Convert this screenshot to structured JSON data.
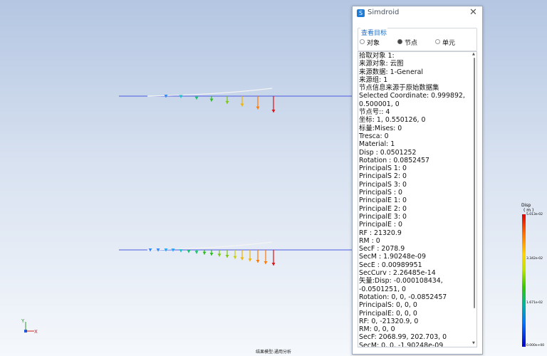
{
  "dialog": {
    "title": "Simdroid",
    "close_glyph": "✕",
    "group_title": "查看目标",
    "radio_options": [
      "对象",
      "节点",
      "单元"
    ],
    "selected_option": "节点",
    "info_lines": [
      "拾取对象 1:",
      "来源对象: 云图",
      "来源数据: 1-General",
      "来源组: 1",
      "节点信息来源于原始数据集",
      "Selected Coordinate: 0.999892, 0.500001, 0",
      "节点号:: 4",
      "坐标: 1, 0.550126, 0",
      "标量:Mises: 0",
      "Tresca: 0",
      "Material: 1",
      "Disp : 0.0501252",
      "Rotation : 0.0852457",
      "PrincipalS 1: 0",
      "PrincipalS 2: 0",
      "PrincipalS 3: 0",
      "PrincipalS : 0",
      "PrincipalE 1: 0",
      "PrincipalE 2: 0",
      "PrincipalE 3: 0",
      "PrincipalE : 0",
      "RF : 21320.9",
      "RM : 0",
      "SecF : 2078.9",
      "SecM : 1.90248e-09",
      "SecE : 0.00989951",
      "SecCurv : 2.26485e-14",
      "矢量:Disp: -0.000108434, -0.0501251, 0",
      "Rotation: 0, 0, -0.0852457",
      "PrincipalS: 0, 0, 0",
      "PrincipalE: 0, 0, 0",
      "RF: 0, -21320.9, 0",
      "RM: 0, 0, 0",
      "SecF: 2068.99, 202.703, 0",
      "SecM: 0, 0, -1.90248e-09"
    ]
  },
  "legend": {
    "title": "Disp",
    "unit": "( m )",
    "ticks": [
      "5.013e-02",
      "3.342e-02",
      "1.671e-02",
      "0.000e+00"
    ],
    "colors": [
      "#e00000",
      "#ff6a00",
      "#ffd200",
      "#35c800",
      "#00b39b",
      "#0073ff",
      "#0000cc"
    ]
  },
  "triad": {
    "x_label": "X",
    "y_label": "Y"
  },
  "status": {
    "model_type": "结果模型:通用分析"
  },
  "beams": {
    "line_color": "#4d5ae0",
    "deformed_color": "#f4f4f4",
    "arrow_colors": [
      "#3a55ff",
      "#2f86ff",
      "#1aa9ff",
      "#12c2c8",
      "#18c46a",
      "#2fbd1e",
      "#7ac812",
      "#c9cc10",
      "#f1b400",
      "#ff7a00",
      "#d81414"
    ]
  }
}
